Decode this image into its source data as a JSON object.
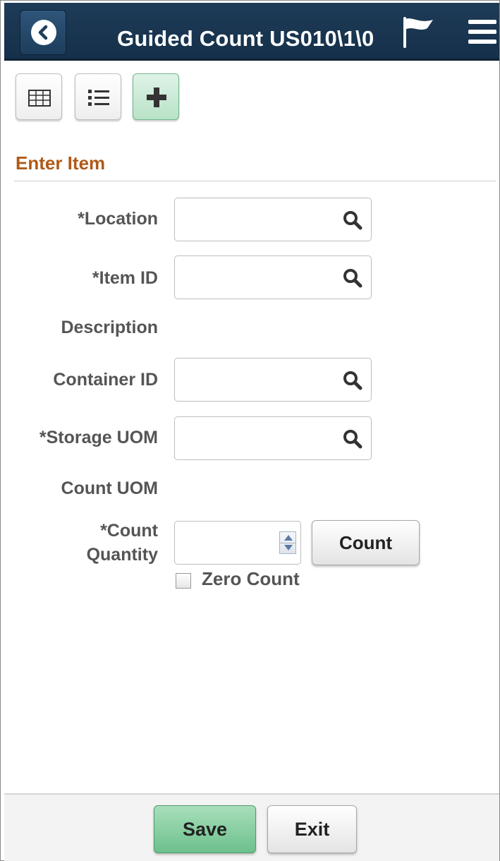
{
  "header": {
    "title": "Guided Count US010\\1\\0",
    "back_icon": "chevron-left-icon",
    "flag_icon": "flag-icon",
    "menu_icon": "hamburger-menu-icon",
    "bg_color": "#1e3b57"
  },
  "toolbar": {
    "buttons": [
      {
        "icon": "grid-view-icon",
        "active": false
      },
      {
        "icon": "list-view-icon",
        "active": false
      },
      {
        "icon": "add-icon",
        "active": true
      }
    ]
  },
  "section": {
    "title": "Enter Item",
    "title_color": "#b05a18"
  },
  "form": {
    "location_label": "*Location",
    "location_value": "",
    "item_id_label": "*Item ID",
    "item_id_value": "",
    "description_label": "Description",
    "container_id_label": "Container ID",
    "container_id_value": "",
    "storage_uom_label": "*Storage UOM",
    "storage_uom_value": "",
    "count_uom_label": "Count UOM",
    "count_quantity_label_line1": "*Count",
    "count_quantity_label_line2": "Quantity",
    "count_quantity_value": "",
    "count_button_label": "Count",
    "zero_count_label": "Zero Count",
    "zero_count_checked": false
  },
  "footer": {
    "save_label": "Save",
    "exit_label": "Exit",
    "save_color": "#6cc08b"
  }
}
